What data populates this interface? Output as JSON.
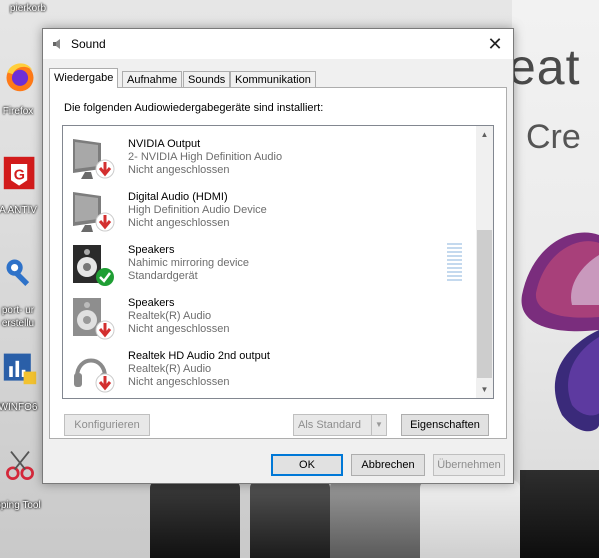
{
  "desktop": {
    "brand_big": "eat",
    "brand_small": "Cre",
    "icons": [
      {
        "label": "pierkorb",
        "icon": "recycle-bin-icon"
      },
      {
        "label": "Firefox",
        "icon": "firefox-icon"
      },
      {
        "label": "A ANTIV",
        "icon": "gdata-antivirus-icon"
      },
      {
        "label": "port- ur",
        "icon": "support-tool-icon"
      },
      {
        "label": "erstellu",
        "icon": "support-tool-icon-2"
      },
      {
        "label": "WINFO6",
        "icon": "hwinfo-icon"
      },
      {
        "label": "pping Tool",
        "icon": "snipping-tool-icon"
      }
    ]
  },
  "dialog": {
    "title": "Sound",
    "close_label": "✕",
    "tabs": [
      {
        "label": "Wiedergabe",
        "active": true
      },
      {
        "label": "Aufnahme",
        "active": false
      },
      {
        "label": "Sounds",
        "active": false
      },
      {
        "label": "Kommunikation",
        "active": false
      }
    ],
    "intro": "Die folgenden Audiowiedergabegeräte sind installiert:",
    "devices": [
      {
        "name": "NVIDIA Output",
        "description": "2- NVIDIA High Definition Audio",
        "status": "Nicht angeschlossen",
        "icon": "monitor-speaker-icon",
        "badge": "disconnected-arrow-icon"
      },
      {
        "name": "Digital Audio (HDMI)",
        "description": "High Definition Audio Device",
        "status": "Nicht angeschlossen",
        "icon": "monitor-speaker-icon",
        "badge": "disconnected-arrow-icon"
      },
      {
        "name": "Speakers",
        "description": "Nahimic mirroring device",
        "status": "Standardgerät",
        "icon": "speaker-box-icon",
        "badge": "default-check-icon"
      },
      {
        "name": "Speakers",
        "description": "Realtek(R) Audio",
        "status": "Nicht angeschlossen",
        "icon": "speaker-box-icon",
        "badge": "disconnected-arrow-icon"
      },
      {
        "name": "Realtek HD Audio 2nd output",
        "description": "Realtek(R) Audio",
        "status": "Nicht angeschlossen",
        "icon": "headphones-icon",
        "badge": "disconnected-arrow-icon"
      }
    ],
    "buttons": {
      "configure": "Konfigurieren",
      "set_default": "Als Standard",
      "properties": "Eigenschaften",
      "ok": "OK",
      "cancel": "Abbrechen",
      "apply": "Übernehmen"
    },
    "colors": {
      "accent": "#0078d7",
      "check": "#1f9e34",
      "disconnected": "#d32f2f"
    }
  }
}
